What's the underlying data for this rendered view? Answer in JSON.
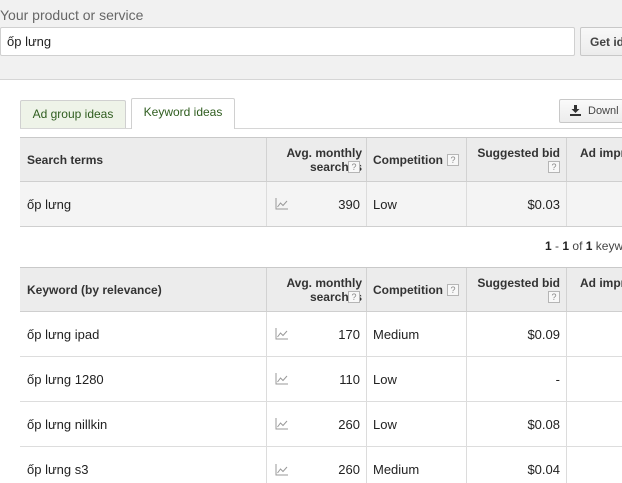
{
  "product_section": {
    "label": "Your product or service",
    "input_value": "ốp lưng",
    "get_ideas_label": "Get id"
  },
  "tabs": [
    {
      "label": "Ad group ideas",
      "active": false
    },
    {
      "label": "Keyword ideas",
      "active": true
    }
  ],
  "download_label": "Downl",
  "search_terms_table": {
    "columns": [
      "Search terms",
      "Avg. monthly searches",
      "Competition",
      "Suggested bid",
      "Ad impr"
    ],
    "help_glyph": "?",
    "rows": [
      {
        "term": "ốp lưng",
        "avg_searches": "390",
        "competition": "Low",
        "suggested_bid": "$0.03"
      }
    ]
  },
  "pager": {
    "start": "1",
    "dash": "-",
    "end": "1",
    "of_label": "of",
    "total": "1",
    "suffix": "keyw"
  },
  "keyword_table": {
    "columns": [
      "Keyword (by relevance)",
      "Avg. monthly searches",
      "Competition",
      "Suggested bid",
      "Ad impr"
    ],
    "rows": [
      {
        "term": "ốp lưng ipad",
        "avg_searches": "170",
        "competition": "Medium",
        "suggested_bid": "$0.09"
      },
      {
        "term": "ốp lưng 1280",
        "avg_searches": "110",
        "competition": "Low",
        "suggested_bid": "-"
      },
      {
        "term": "ốp lưng nillkin",
        "avg_searches": "260",
        "competition": "Low",
        "suggested_bid": "$0.08"
      },
      {
        "term": "ốp lưng s3",
        "avg_searches": "260",
        "competition": "Medium",
        "suggested_bid": "$0.04"
      }
    ]
  },
  "icons": {
    "trend": "trend-chart-icon",
    "download": "download-icon",
    "help": "help-icon"
  }
}
